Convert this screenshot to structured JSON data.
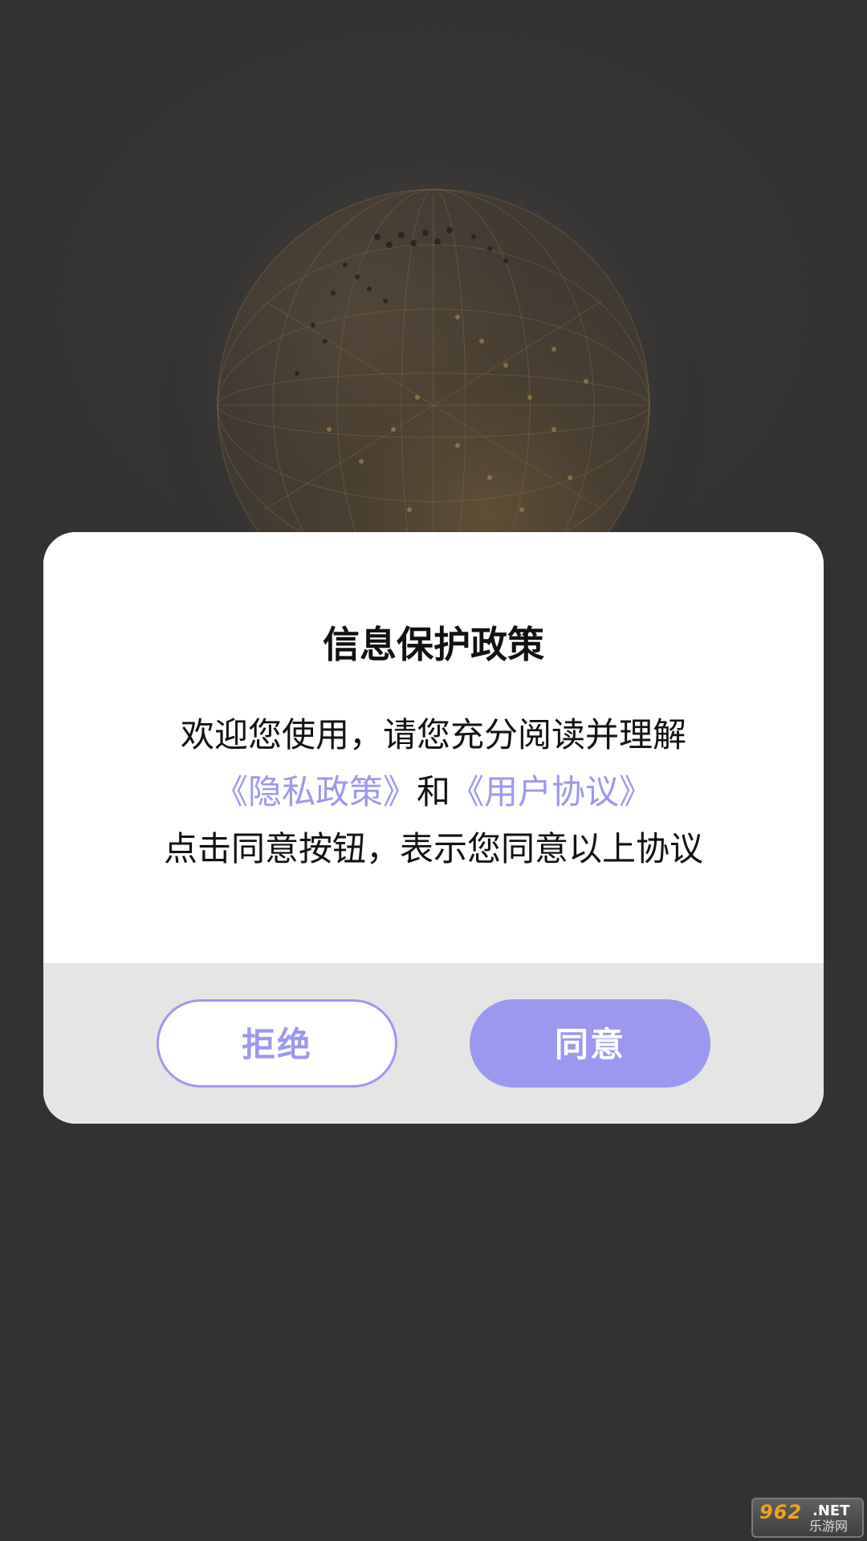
{
  "dialog": {
    "title": "信息保护政策",
    "line1": "欢迎您使用，请您充分阅读并理解",
    "privacy_link": "《隐私政策》",
    "and_text": "和",
    "user_agreement_link": "《用户协议》",
    "line3": "点击同意按钮，表示您同意以上协议",
    "reject_label": "拒绝",
    "accept_label": "同意"
  },
  "watermark": {
    "main": "962",
    "suffix": ".NET",
    "sub": "乐游网"
  },
  "colors": {
    "accent": "#9c98ef",
    "background": "#313232",
    "footer": "#e5e5e5"
  },
  "icons": {
    "background_image": "globe-network-image"
  }
}
